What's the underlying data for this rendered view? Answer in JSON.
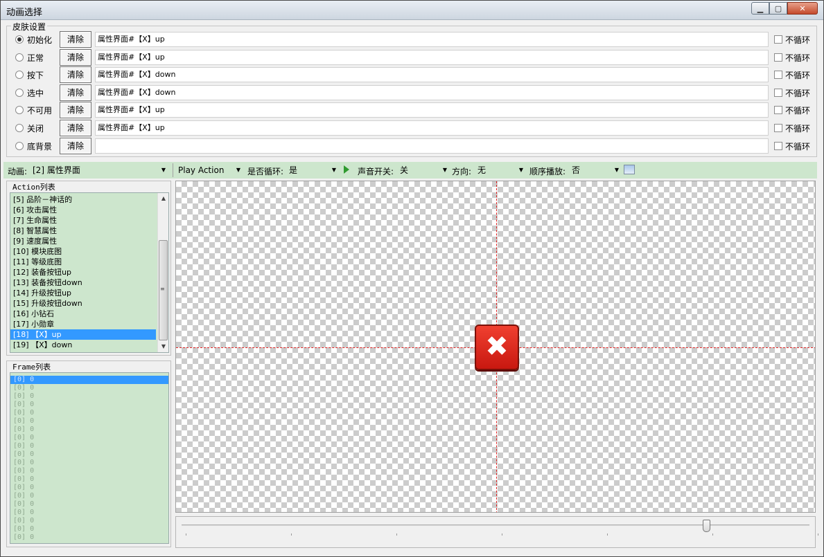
{
  "window": {
    "title": "动画选择",
    "min_icon": "▁",
    "max_icon": "▢",
    "close_icon": "✕"
  },
  "skin": {
    "legend": "皮肤设置",
    "rows": [
      {
        "label": "初始化",
        "checked": true,
        "clear": "清除",
        "path": "属性界面#【X】up",
        "loop": "不循环"
      },
      {
        "label": "正常",
        "checked": false,
        "clear": "清除",
        "path": "属性界面#【X】up",
        "loop": "不循环"
      },
      {
        "label": "按下",
        "checked": false,
        "clear": "清除",
        "path": "属性界面#【X】down",
        "loop": "不循环"
      },
      {
        "label": "选中",
        "checked": false,
        "clear": "清除",
        "path": "属性界面#【X】down",
        "loop": "不循环"
      },
      {
        "label": "不可用",
        "checked": false,
        "clear": "清除",
        "path": "属性界面#【X】up",
        "loop": "不循环"
      },
      {
        "label": "关闭",
        "checked": false,
        "clear": "清除",
        "path": "属性界面#【X】up",
        "loop": "不循环"
      },
      {
        "label": "底背景",
        "checked": false,
        "clear": "清除",
        "path": "",
        "loop": "不循环"
      }
    ]
  },
  "toolbar": {
    "anim_label": "动画:",
    "anim_value": "[2] 属性界面",
    "action_value": "Play Action",
    "loop_label": "是否循环:",
    "loop_value": "是",
    "sound_label": "声音开关:",
    "sound_value": "关",
    "dir_label": "方向:",
    "dir_value": "无",
    "seq_label": "顺序播放:",
    "seq_value": "否",
    "arrow": "▼"
  },
  "action_list": {
    "title": "Action列表",
    "items": [
      "[5] 品阶－神话的",
      "[6] 攻击属性",
      "[7] 生命属性",
      "[8] 智慧属性",
      "[9] 速度属性",
      "[10] 模块底图",
      "[11] 等级底图",
      "[12] 装备按钮up",
      "[13] 装备按钮down",
      "[14] 升级按钮up",
      "[15] 升级按钮down",
      "[16] 小钻石",
      "[17] 小勋章",
      "[18] 【X】up",
      "[19] 【X】down"
    ],
    "selected": 13,
    "scroll_up": "▲",
    "scroll_down": "▼",
    "grip": "≡"
  },
  "frame_list": {
    "title": "Frame列表",
    "items": [
      "[0] 0",
      "[0] 0",
      "[0] 0",
      "[0] 0",
      "[0] 0",
      "[0] 0",
      "[0] 0",
      "[0] 0",
      "[0] 0",
      "[0] 0",
      "[0] 0",
      "[0] 0",
      "[0] 0",
      "[0] 0",
      "[0] 0",
      "[0] 0",
      "[0] 0",
      "[0] 0",
      "[0] 0",
      "[0] 0"
    ],
    "selected": 0
  },
  "preview": {
    "sprite_glyph": "✖",
    "accent": "#e02020"
  },
  "timeline": {
    "value_fraction": 0.83
  }
}
